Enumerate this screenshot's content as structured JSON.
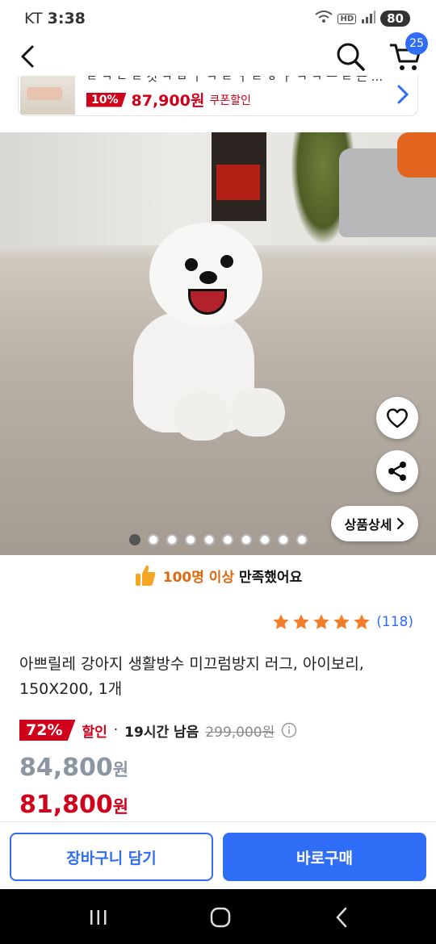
{
  "status": {
    "carrier": "KT",
    "time": "3:38",
    "battery": "80"
  },
  "header": {
    "cart_count": "25"
  },
  "promo": {
    "cut_text": "ㄹ ㅋ ㄷ ㄹ 것 ㅋ ㅂ ㅣ ㅋ ㄹ ㅓ ㄹ ㅎ ㅏ ㅋ ㅋ ㅡ ㄹ 근 ...",
    "discount": "10%",
    "price": "87,900원",
    "coupon": "쿠폰할인"
  },
  "hero": {
    "detail_button": "상품상세",
    "slide_count": 10,
    "active_slide": 0
  },
  "satisfaction": {
    "highlight": "100명 이상",
    "text": "만족했어요"
  },
  "rating": {
    "stars": 5,
    "count": "(118)"
  },
  "product": {
    "title_line1": "아쁘릴레 강아지 생활방수 미끄럼방지 러그, 아이보리,",
    "title_line2": "150X200, 1개"
  },
  "pricing": {
    "discount_pct": "72%",
    "discount_label": "할인",
    "separator": "·",
    "time_left": "19시간 남음",
    "original_price": "299,000원",
    "price1_value": "84,800",
    "price1_unit": "원",
    "price2_value": "81,800",
    "price2_unit": "원"
  },
  "actions": {
    "add_to_cart": "장바구니 담기",
    "buy_now": "바로구매"
  },
  "colors": {
    "accent": "#2f6df6",
    "sale": "#d0021b",
    "star": "#f27e2a",
    "satisfy": "#e0680f"
  }
}
